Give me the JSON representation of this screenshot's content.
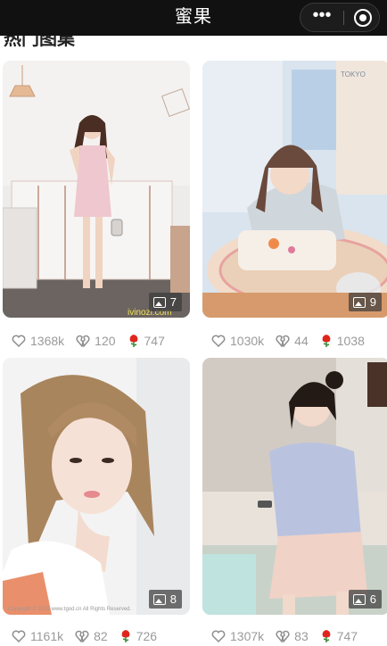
{
  "app": {
    "title": "蜜果",
    "section_title": "热门图集"
  },
  "capsule": {
    "more_label": "•••"
  },
  "cards": [
    {
      "image_count": "7",
      "likes": "1368k",
      "broken": "120",
      "roses": "747",
      "photo": "girl-in-pink-dress-room"
    },
    {
      "image_count": "9",
      "likes": "1030k",
      "broken": "44",
      "roses": "1038",
      "photo": "girl-lying-on-rug"
    },
    {
      "image_count": "8",
      "likes": "1161k",
      "broken": "82",
      "roses": "726",
      "photo": "girl-hand-on-chin-white"
    },
    {
      "image_count": "6",
      "likes": "1307k",
      "broken": "83",
      "roses": "747",
      "photo": "girl-sitting-lavender-cardigan"
    }
  ],
  "colors": {
    "titlebar": "#111111",
    "stat_text": "#9a9a9a",
    "rose": "#e0261c"
  }
}
